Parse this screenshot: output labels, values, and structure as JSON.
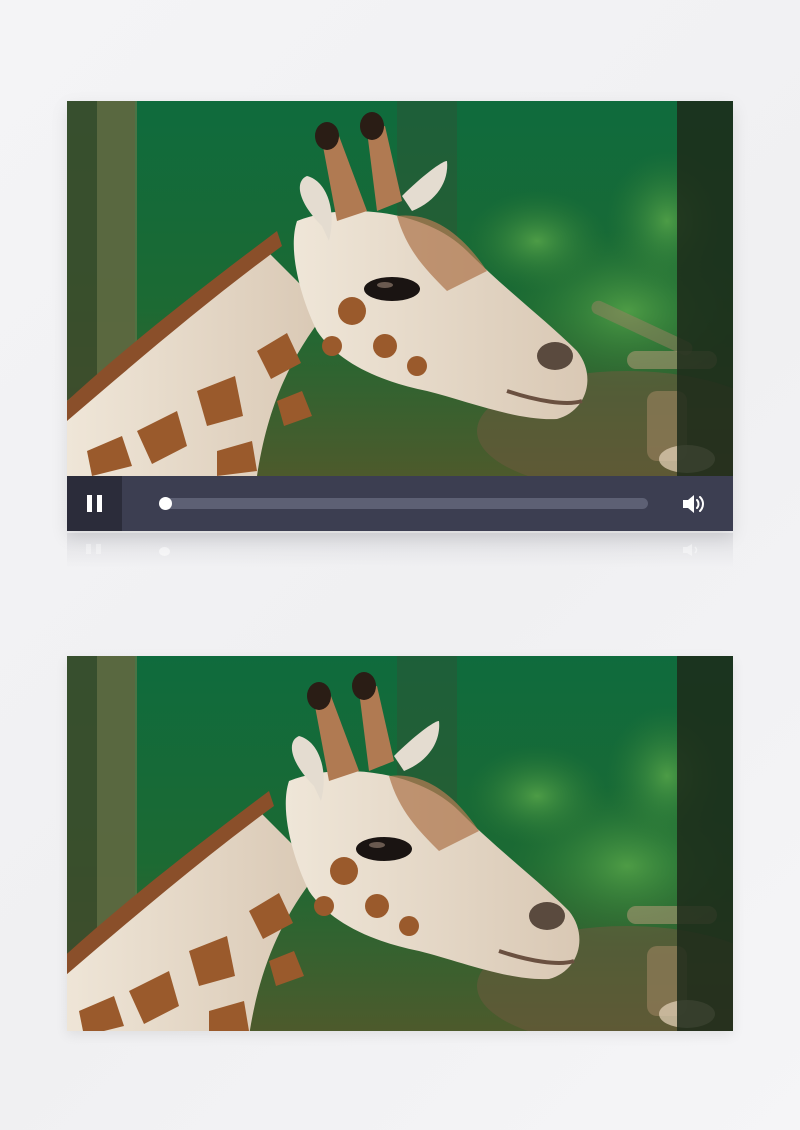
{
  "video": {
    "subject": "giraffe-head-closeup",
    "state": "paused-at-start",
    "progress": 0.0
  },
  "controls": {
    "play_pause_icon": "pause-icon",
    "volume_icon": "speaker-volume-icon"
  },
  "colors": {
    "page_background": "#f2f2f4",
    "control_bar": "#3c3e51",
    "play_button_bg": "#2b2c3a",
    "track": "#5d6074",
    "knob": "#ffffff"
  }
}
